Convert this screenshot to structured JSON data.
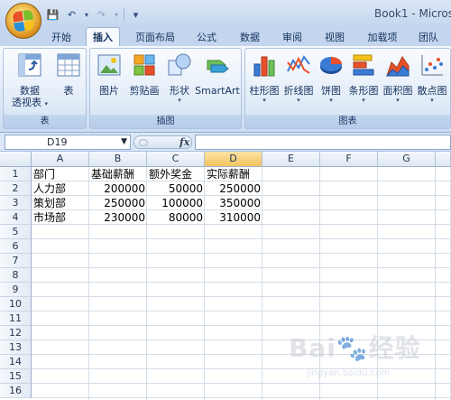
{
  "window": {
    "title": "Book1 - Micros"
  },
  "quick_access": {
    "save": "💾",
    "undo": "↶",
    "redo": "↷",
    "more": "▾"
  },
  "tabs": [
    {
      "label": "开始",
      "active": false
    },
    {
      "label": "插入",
      "active": true
    },
    {
      "label": "页面布局",
      "active": false
    },
    {
      "label": "公式",
      "active": false
    },
    {
      "label": "数据",
      "active": false
    },
    {
      "label": "审阅",
      "active": false
    },
    {
      "label": "视图",
      "active": false
    },
    {
      "label": "加载项",
      "active": false
    },
    {
      "label": "团队",
      "active": false
    }
  ],
  "ribbon": {
    "groups": {
      "table": "表",
      "illustrations": "插图",
      "charts": "图表"
    },
    "buttons": {
      "pivot_line1": "数据",
      "pivot_line2": "透视表",
      "table": "表",
      "picture": "图片",
      "clipart": "剪贴画",
      "shapes": "形状",
      "smartart": "SmartArt",
      "column": "柱形图",
      "line": "折线图",
      "pie": "饼图",
      "bar": "条形图",
      "area": "面积图",
      "scatter": "散点图"
    }
  },
  "formula_bar": {
    "name_box": "D19",
    "fx": "fx",
    "value": ""
  },
  "sheet": {
    "columns": [
      "A",
      "B",
      "C",
      "D",
      "E",
      "F",
      "G"
    ],
    "selected_column": "D",
    "rows": [
      "1",
      "2",
      "3",
      "4",
      "5",
      "6",
      "7",
      "8",
      "9",
      "10",
      "11",
      "12",
      "13",
      "14",
      "15",
      "16"
    ],
    "cells": [
      [
        "部门",
        "基础薪酬",
        "额外奖金",
        "实际薪酬"
      ],
      [
        "人力部",
        "200000",
        "50000",
        "250000"
      ],
      [
        "策划部",
        "250000",
        "100000",
        "350000"
      ],
      [
        "市场部",
        "230000",
        "80000",
        "310000"
      ]
    ]
  },
  "watermark": {
    "brand": "Bai🐾经验",
    "url": "jingyan.baidu.com"
  }
}
